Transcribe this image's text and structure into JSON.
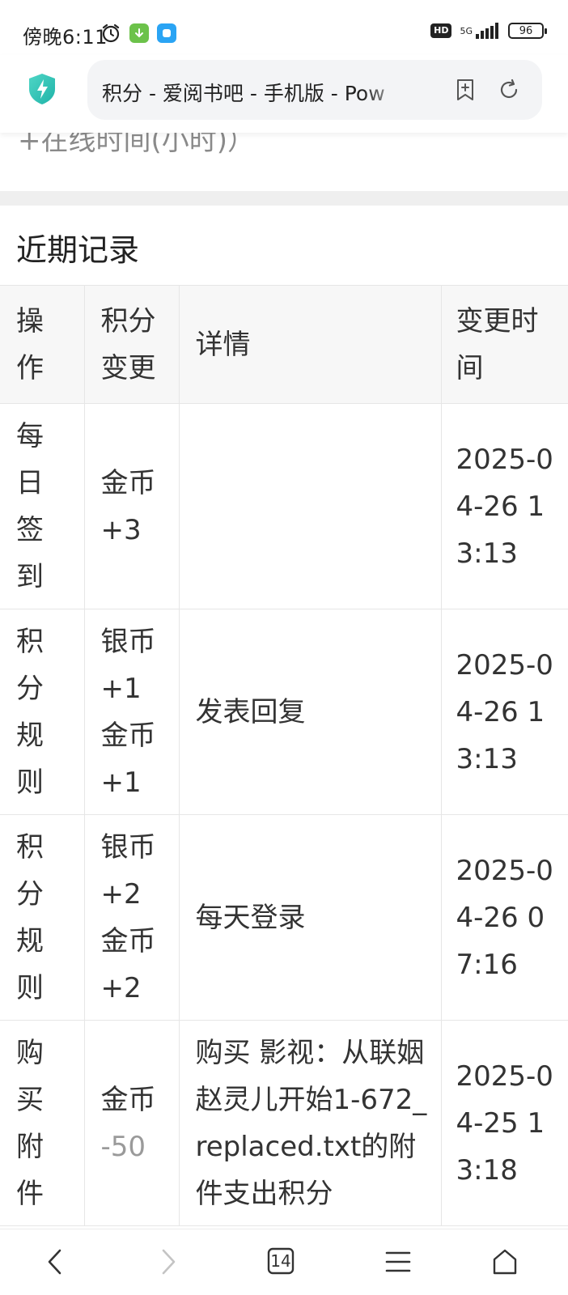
{
  "status_bar": {
    "time": "傍晚6:11",
    "network": "5G",
    "hd": "HD",
    "battery": "96"
  },
  "browser": {
    "page_title": "积分 - 爱阅书吧 - 手机版 - Pow",
    "tab_count": "14"
  },
  "page": {
    "partial_text": "+在线时间(小时)）",
    "section_title": "近期记录",
    "table": {
      "headers": [
        "操作",
        "积分变更",
        "详情",
        "变更时间"
      ],
      "rows": [
        {
          "op": "每日签到",
          "change1": "金币",
          "change1_value": "+3",
          "change2": "",
          "change2_value": "",
          "detail": "",
          "time": "2025-04-26 13:13"
        },
        {
          "op": "积分规则",
          "change1": "银币",
          "change1_value": "+1",
          "change2": "金币",
          "change2_value": "+1",
          "detail": "发表回复",
          "time": "2025-04-26 13:13"
        },
        {
          "op": "积分规则",
          "change1": "银币",
          "change1_value": "+2",
          "change2": "金币",
          "change2_value": "+2",
          "detail": "每天登录",
          "time": "2025-04-26 07:16"
        },
        {
          "op": "购买附件",
          "change1": "金币",
          "change1_value": "-50",
          "change2": "",
          "change2_value": "",
          "detail": "购买 影视：从联姻赵灵儿开始1-672_replaced.txt的附件支出积分",
          "time": "2025-04-25 13:18"
        }
      ]
    }
  },
  "colors": {
    "accent": "#2ec4b6",
    "text": "#333333",
    "muted": "#9a9a9a"
  },
  "icons": [
    "alarm-icon",
    "download-app-icon",
    "browser-app-icon",
    "shield-icon",
    "bookmark-add-icon",
    "reload-icon",
    "back-icon",
    "forward-icon",
    "tabs-icon",
    "menu-icon",
    "home-icon"
  ]
}
